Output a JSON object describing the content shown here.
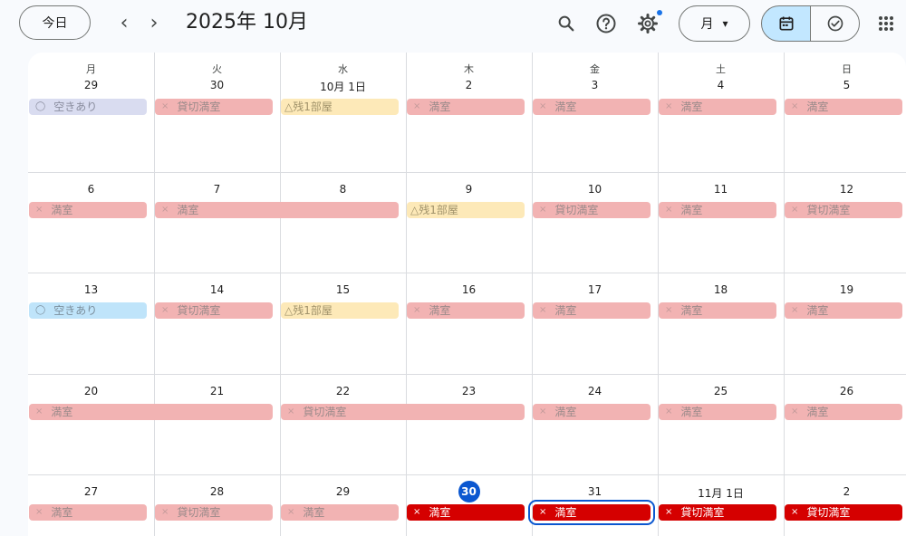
{
  "toolbar": {
    "today_label": "今日",
    "prev_label": "‹",
    "next_label": "›",
    "title": "2025年 10月",
    "view_label": "月",
    "view_caret": "▾"
  },
  "weekdays": [
    "月",
    "火",
    "水",
    "木",
    "金",
    "土",
    "日"
  ],
  "weeks": [
    {
      "dates": [
        "29",
        "30",
        "10月 1日",
        "2",
        "3",
        "4",
        "5"
      ]
    },
    {
      "dates": [
        "6",
        "7",
        "8",
        "9",
        "10",
        "11",
        "12"
      ]
    },
    {
      "dates": [
        "13",
        "14",
        "15",
        "16",
        "17",
        "18",
        "19"
      ]
    },
    {
      "dates": [
        "20",
        "21",
        "22",
        "23",
        "24",
        "25",
        "26"
      ]
    },
    {
      "dates": [
        "27",
        "28",
        "29",
        "30",
        "31",
        "11月 1日",
        "2"
      ]
    }
  ],
  "today_index": {
    "week": 4,
    "day": 3
  },
  "events": [
    {
      "week": 0,
      "start": 0,
      "span": 1,
      "style": "circ-grey",
      "icon": "◯",
      "label": "空きあり"
    },
    {
      "week": 0,
      "start": 1,
      "span": 1,
      "style": "x",
      "icon": "×",
      "label": "貸切満室"
    },
    {
      "week": 0,
      "start": 2,
      "span": 1,
      "style": "tri",
      "icon": "",
      "label": "△残1部屋"
    },
    {
      "week": 0,
      "start": 3,
      "span": 1,
      "style": "x",
      "icon": "×",
      "label": "満室"
    },
    {
      "week": 0,
      "start": 4,
      "span": 1,
      "style": "x",
      "icon": "×",
      "label": "満室"
    },
    {
      "week": 0,
      "start": 5,
      "span": 1,
      "style": "x",
      "icon": "×",
      "label": "満室"
    },
    {
      "week": 0,
      "start": 6,
      "span": 1,
      "style": "x",
      "icon": "×",
      "label": "満室"
    },
    {
      "week": 1,
      "start": 0,
      "span": 1,
      "style": "x",
      "icon": "×",
      "label": "満室"
    },
    {
      "week": 1,
      "start": 1,
      "span": 2,
      "style": "x",
      "icon": "×",
      "label": "満室"
    },
    {
      "week": 1,
      "start": 3,
      "span": 1,
      "style": "tri",
      "icon": "",
      "label": "△残1部屋"
    },
    {
      "week": 1,
      "start": 4,
      "span": 1,
      "style": "x",
      "icon": "×",
      "label": "貸切満室"
    },
    {
      "week": 1,
      "start": 5,
      "span": 1,
      "style": "x",
      "icon": "×",
      "label": "満室"
    },
    {
      "week": 1,
      "start": 6,
      "span": 1,
      "style": "x",
      "icon": "×",
      "label": "貸切満室"
    },
    {
      "week": 2,
      "start": 0,
      "span": 1,
      "style": "circ-blue",
      "icon": "◯",
      "label": "空きあり"
    },
    {
      "week": 2,
      "start": 1,
      "span": 1,
      "style": "x",
      "icon": "×",
      "label": "貸切満室"
    },
    {
      "week": 2,
      "start": 2,
      "span": 1,
      "style": "tri",
      "icon": "",
      "label": "△残1部屋"
    },
    {
      "week": 2,
      "start": 3,
      "span": 1,
      "style": "x",
      "icon": "×",
      "label": "満室"
    },
    {
      "week": 2,
      "start": 4,
      "span": 1,
      "style": "x",
      "icon": "×",
      "label": "満室"
    },
    {
      "week": 2,
      "start": 5,
      "span": 1,
      "style": "x",
      "icon": "×",
      "label": "満室"
    },
    {
      "week": 2,
      "start": 6,
      "span": 1,
      "style": "x",
      "icon": "×",
      "label": "満室"
    },
    {
      "week": 3,
      "start": 0,
      "span": 2,
      "style": "x",
      "icon": "×",
      "label": "満室"
    },
    {
      "week": 3,
      "start": 2,
      "span": 2,
      "style": "x",
      "icon": "×",
      "label": "貸切満室"
    },
    {
      "week": 3,
      "start": 4,
      "span": 1,
      "style": "x",
      "icon": "×",
      "label": "満室"
    },
    {
      "week": 3,
      "start": 5,
      "span": 1,
      "style": "x",
      "icon": "×",
      "label": "満室"
    },
    {
      "week": 3,
      "start": 6,
      "span": 1,
      "style": "x",
      "icon": "×",
      "label": "満室"
    },
    {
      "week": 4,
      "start": 0,
      "span": 1,
      "style": "x",
      "icon": "×",
      "label": "満室"
    },
    {
      "week": 4,
      "start": 1,
      "span": 1,
      "style": "x",
      "icon": "×",
      "label": "貸切満室"
    },
    {
      "week": 4,
      "start": 2,
      "span": 1,
      "style": "x",
      "icon": "×",
      "label": "満室"
    },
    {
      "week": 4,
      "start": 3,
      "span": 1,
      "style": "red",
      "icon": "×",
      "label": "満室"
    },
    {
      "week": 4,
      "start": 4,
      "span": 1,
      "style": "red sel",
      "icon": "×",
      "label": "満室"
    },
    {
      "week": 4,
      "start": 5,
      "span": 1,
      "style": "red",
      "icon": "×",
      "label": "貸切満室"
    },
    {
      "week": 4,
      "start": 6,
      "span": 1,
      "style": "red",
      "icon": "×",
      "label": "貸切満室"
    }
  ],
  "colors": {
    "accent": "#0b57d0",
    "full": "#f2b3b3",
    "full_current": "#d50000",
    "partial": "#fde9b8",
    "available_grey": "#d9dcf0",
    "available_blue": "#bfe4fa",
    "segment_active": "#c2e7ff"
  },
  "icons": {
    "search": "search-icon",
    "help": "help-icon",
    "settings": "settings-icon",
    "calendar": "calendar-icon",
    "tasks": "tasks-icon",
    "apps": "apps-grid-icon"
  }
}
